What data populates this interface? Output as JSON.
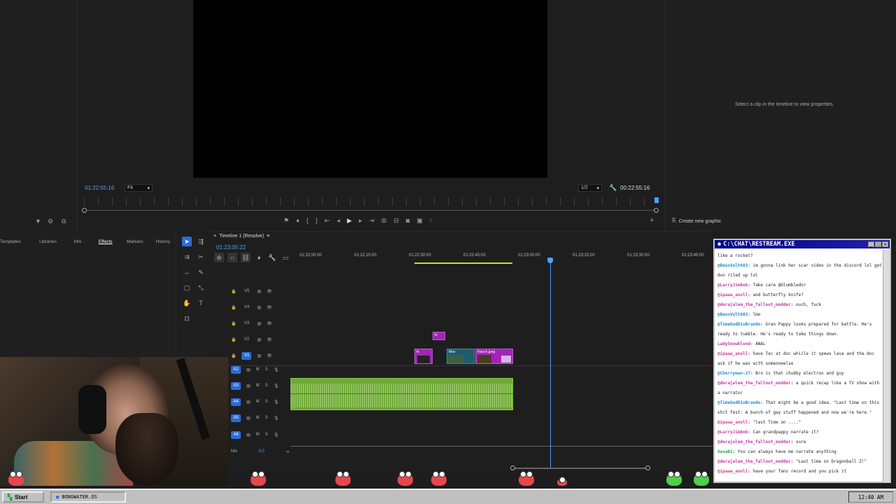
{
  "program_monitor": {
    "current_time": "01:22:55:16",
    "fit_label": "Fit",
    "resolution": "1/2",
    "duration": "00:22:55:16"
  },
  "essential_graphics": {
    "hint": "Select a clip in the timeline to view properties.",
    "create_new": "Create new graphic"
  },
  "panel_tabs": [
    "Templates",
    "Libraries",
    "Info",
    "Effects",
    "Markers",
    "History"
  ],
  "panel_tabs_more": "»",
  "timeline": {
    "title": "Timeline 1 (Resolve)",
    "timecode": "01:23:05:22",
    "ruler_labels": [
      "01:22:00:00",
      "01:22:15:00",
      "01:22:30:00",
      "01:22:45:00",
      "01:23:00:00",
      "01:23:15:00",
      "01:23:30:00",
      "01:23:45:00"
    ],
    "video_tracks": [
      "V5",
      "V4",
      "V3",
      "V2",
      "V1"
    ],
    "audio_tracks": [
      "A2",
      "A3",
      "A4",
      "A5",
      "A6"
    ],
    "mix_label": "Mix",
    "mix_value": "0.0",
    "clip_labels": {
      "fx1": "fx",
      "fx2": "fx",
      "mov": "Mov",
      "ranch": "Ranch.jpeg"
    }
  },
  "chat": {
    "title": "C:\\CHAT\\RESTREAM.EXE",
    "messages": [
      {
        "user": "",
        "text": "like a rocket?",
        "color": "#222222"
      },
      {
        "user": "@DeusVult603",
        "text": "im gonna link her scar video in the discord lol get don riled up lol",
        "color": "#1a8ad4"
      },
      {
        "user": "@LarryJimbob",
        "text": "Take care @Glumbledor",
        "color": "#c23aa8"
      },
      {
        "user": "@ipaaa_anoll",
        "text": "and butterfly knife?",
        "color": "#d93a8a"
      },
      {
        "user": "@derajalem_the_fallout_modder",
        "text": "ouch, fuck",
        "color": "#c23aa8"
      },
      {
        "user": "@DeusVult603",
        "text": "lmo",
        "color": "#1a8ad4"
      },
      {
        "user": "@TimeGodDioBrando",
        "text": "Gran Pappy looks prepared for battle. He's ready to tumble. He's ready to take things down.",
        "color": "#1a8ad4"
      },
      {
        "user": "LadySnowblood",
        "text": "ANAL",
        "color": "#c23aa8"
      },
      {
        "user": "@ipaaa_anoll",
        "text": "have Tec at doc whiile it spews lava and the doc ask if he was with someoneelse",
        "color": "#d93a8a"
      },
      {
        "user": "@Cherryman-27",
        "text": "Bro is that chubby electron and guy",
        "color": "#1a8ad4"
      },
      {
        "user": "@derajalem_the_fallout_modder",
        "text": "a quick recap like a TV show with a narrator",
        "color": "#c23aa8"
      },
      {
        "user": "@TimeGodDioBrando",
        "text": "That might be a good idea. \"Last time on this shit fest: A bunch of gay stuff happened and now we're here.\"",
        "color": "#1a8ad4"
      },
      {
        "user": "@ipaaa_anoll",
        "text": "\"last Time on ....\"",
        "color": "#d93a8a"
      },
      {
        "user": "@LarryJimbob",
        "text": "Can grandpappy narrate it?",
        "color": "#c23aa8"
      },
      {
        "user": "@derajalem_the_fallout_modder",
        "text": "sure",
        "color": "#c23aa8"
      },
      {
        "user": "Aosabi",
        "text": "You can always have me narrate anything",
        "color": "#1aa84a"
      },
      {
        "user": "@derajalem_the_fallout_modder",
        "text": "\"Last time on Dragonball Z!\"",
        "color": "#c23aa8"
      },
      {
        "user": "@ipaaa_anoll",
        "text": "have your fans record and you pick it",
        "color": "#d93a8a"
      }
    ]
  },
  "taskbar": {
    "start_label": "Start",
    "task_label": "BONGWATER.OS",
    "clock": "12:40 AM"
  },
  "colors": {
    "accent_blue": "#2b6bd6",
    "clip_purple": "#a323b8",
    "audio_green": "#6fa937",
    "chat_title": "#000088"
  }
}
